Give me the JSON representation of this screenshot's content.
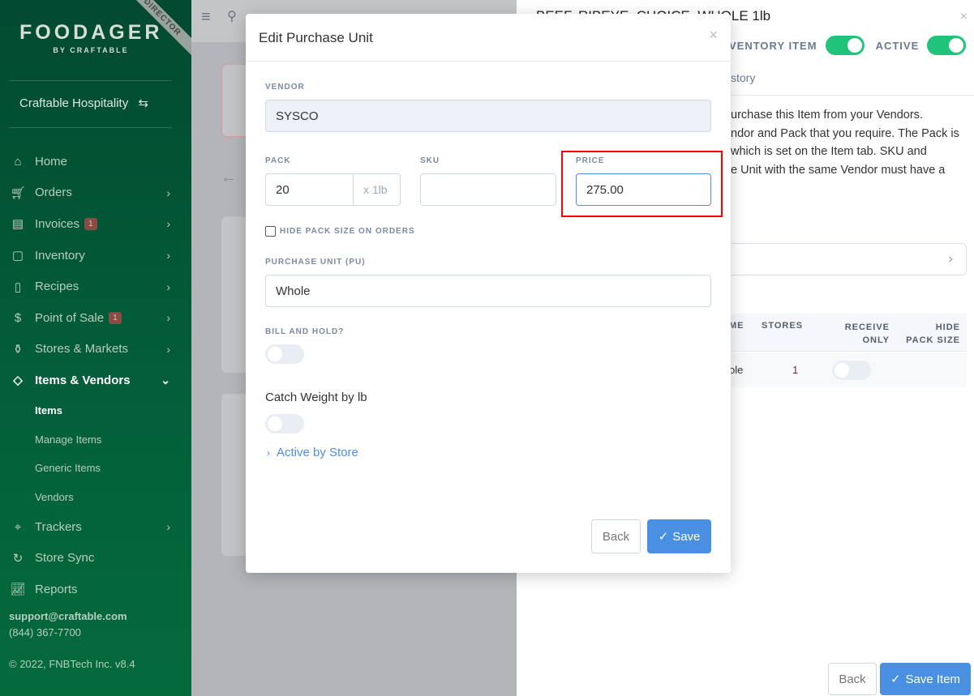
{
  "sidebar": {
    "ribbon": "DIRECTOR",
    "logo_main": "FOODAGER",
    "logo_sub": "BY CRAFTABLE",
    "org": "Craftable Hospitality",
    "items": [
      {
        "label": "Home",
        "icon": "home-icon"
      },
      {
        "label": "Orders",
        "icon": "cart-icon"
      },
      {
        "label": "Invoices",
        "icon": "invoice-icon",
        "badge": "1"
      },
      {
        "label": "Inventory",
        "icon": "box-icon"
      },
      {
        "label": "Recipes",
        "icon": "book-icon"
      },
      {
        "label": "Point of Sale",
        "icon": "dollar-icon",
        "badge": "1"
      },
      {
        "label": "Stores & Markets",
        "icon": "bottles-icon"
      },
      {
        "label": "Items & Vendors",
        "icon": "tag-icon"
      }
    ],
    "subitems": [
      "Items",
      "Manage Items",
      "Generic Items",
      "Vendors"
    ],
    "items2": [
      {
        "label": "Trackers",
        "icon": "pin-icon"
      },
      {
        "label": "Store Sync",
        "icon": "sync-icon"
      },
      {
        "label": "Reports",
        "icon": "chart-icon"
      }
    ],
    "email": "support@craftable.com",
    "phone": "(844) 367-7700",
    "copyright": "© 2022, FNBTech Inc. v8.4"
  },
  "right": {
    "title": "BEEF, RIBEYE, CHOICE, WHOLE 1lb",
    "inventory_label": "VENTORY ITEM",
    "active_label": "ACTIVE",
    "tab": "story",
    "description": [
      "urchase this Item from your Vendors.",
      "ndor and Pack that you require. The Pack is",
      " which is set on the Item tab. SKU and",
      "e Unit with the same Vendor must have a"
    ],
    "columns": [
      "ME",
      "STORES",
      "RECEIVE ONLY",
      "HIDE PACK SIZE"
    ],
    "row": {
      "name": "ole",
      "stores": "1"
    },
    "back": "Back",
    "save": "Save Item"
  },
  "modal": {
    "title": "Edit Purchase Unit",
    "vendor_label": "VENDOR",
    "vendor": "SYSCO",
    "pack_label": "PACK",
    "pack": "20",
    "pack_unit": "x 1lb",
    "sku_label": "SKU",
    "sku": "",
    "price_label": "PRICE",
    "price": "275.00",
    "hide_pack": "HIDE PACK SIZE ON ORDERS",
    "pu_label": "PURCHASE UNIT (PU)",
    "pu": "Whole",
    "bill_hold": "BILL AND HOLD?",
    "catch_weight": "Catch Weight by lb",
    "active_store": "Active by Store",
    "back": "Back",
    "save": "Save"
  },
  "colors": {
    "highlight": "#ff0000",
    "primary": "#4a90e2",
    "toggle_on": "#1fc37a"
  }
}
